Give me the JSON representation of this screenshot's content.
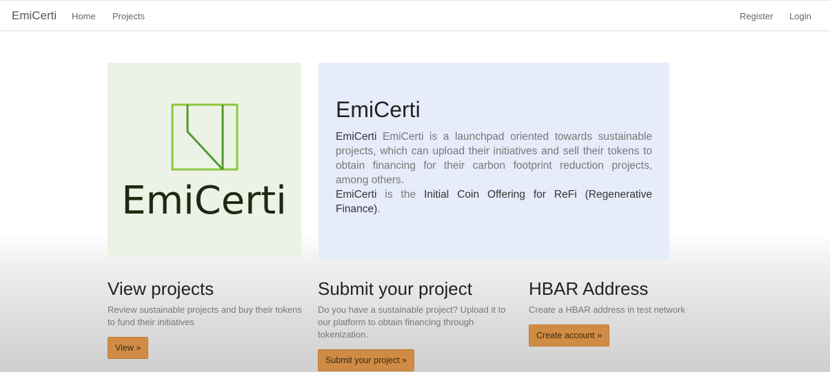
{
  "navbar": {
    "brand": "EmiCerti",
    "links": [
      "Home",
      "Projects"
    ],
    "right_links": [
      "Register",
      "Login"
    ]
  },
  "logo": {
    "text": "EmiCerti"
  },
  "hero": {
    "title": "EmiCerti",
    "p1_bold": "EmiCerti",
    "p1_text": " EmiCerti is a launchpad oriented towards sustainable projects, which can upload their initiatives and sell their tokens to obtain financing for their carbon footprint reduction projects, among others.",
    "p2_bold": "EmiCerti",
    "p2_mid": " is the ",
    "p2_bold2": "Initial Coin Offering for ReFi (Regenerative Finance)",
    "p2_end": "."
  },
  "columns": [
    {
      "title": "View projects",
      "text": "Review sustainable projects and buy their tokens to fund their initiatives",
      "button": "View »"
    },
    {
      "title": "Submit your project",
      "text": "Do you have a sustainable project? Upload it to our platform to obtain financing through tokenization.",
      "button": "Submit your project »"
    },
    {
      "title": "HBAR Address",
      "text": "Create a HBAR address in test network",
      "button": "Create account »"
    }
  ],
  "colors": {
    "logo_green_dark": "#4f9a2e",
    "logo_green_light": "#8cc63f",
    "logo_text": "#1c2a12",
    "hero_bg": "#e6ecfa",
    "logo_bg": "#edf2e6",
    "button": "#d08c45"
  }
}
